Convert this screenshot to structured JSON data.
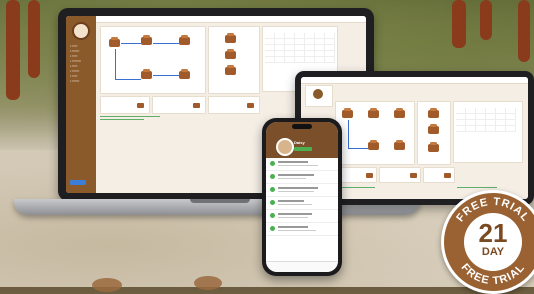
{
  "badge": {
    "top_text": "FREE TRIAL",
    "bottom_text": "FREE TRIAL",
    "number": "21",
    "unit": "DAY"
  },
  "phone": {
    "profile_name": "Daisy"
  },
  "colors": {
    "brand_brown": "#8b5a2b",
    "accent_blue": "#3b7dd8",
    "status_green": "#4caf50"
  },
  "icons": [
    "cow-icon",
    "calendar-icon",
    "avatar"
  ]
}
